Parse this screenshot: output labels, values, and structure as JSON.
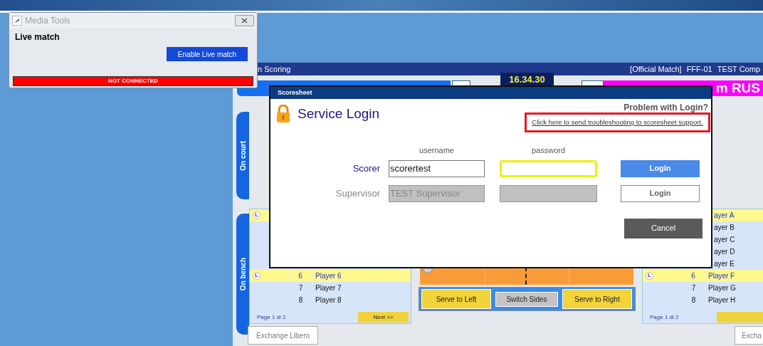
{
  "media_tools": {
    "title": "Media Tools",
    "heading": "Live match",
    "button": "Enable Live match",
    "status": "NOT CONNECTED"
  },
  "scoring_window": {
    "title": "n Scoring",
    "match_info": [
      "[Official Match]",
      "FFF-01",
      "TEST Comp"
    ],
    "clock": "16.34.30",
    "teams": [
      {
        "color": "#1470f0"
      },
      {
        "name": "m RUS",
        "color": "#ff00ff"
      }
    ],
    "side_tabs": [
      "On court",
      "On bench"
    ],
    "benches": [
      {
        "rows": [
          {
            "libero": true,
            "badge": "L"
          },
          {
            "libero": true,
            "badge": "L",
            "number": "6",
            "name": "Player 6"
          },
          {
            "libero": false,
            "number": "7",
            "name": "Player 7"
          },
          {
            "libero": false,
            "number": "8",
            "name": "Player 8"
          }
        ],
        "page": "Page 1 di 2",
        "next": "Next >>"
      },
      {
        "rows": [
          {
            "libero": true,
            "name": "ayer A"
          },
          {
            "libero": false,
            "name": "ayer B"
          },
          {
            "libero": false,
            "name": "ayer C"
          },
          {
            "libero": false,
            "name": "ayer D"
          },
          {
            "libero": false,
            "name": "ayer E"
          },
          {
            "libero": true,
            "badge": "L",
            "number": "6",
            "name": "Player F"
          },
          {
            "libero": false,
            "number": "7",
            "name": "Player G"
          },
          {
            "libero": false,
            "number": "8",
            "name": "Player H"
          }
        ],
        "page": "Page 1 di 2"
      }
    ],
    "court_buttons": [
      {
        "label": "Serve to Left",
        "kind": "serve"
      },
      {
        "label": "Switch Sides",
        "kind": "switch"
      },
      {
        "label": "Serve to Right",
        "kind": "serve"
      }
    ],
    "exchange_buttons": [
      "Exchange Libero",
      "Excha"
    ]
  },
  "login_dialog": {
    "title": "Scoresheet",
    "heading": "Service Login",
    "problem": "Problem with Login?",
    "support_link": "Click here to send troubleshooting to scoresheet support.",
    "columns": [
      "username",
      "password"
    ],
    "rows": [
      {
        "role": "Scorer",
        "username": "scorertest",
        "password_focused": true,
        "disabled": false,
        "button": "Login"
      },
      {
        "role": "Supervisor",
        "username": "TEST Supervisor",
        "password_focused": false,
        "disabled": true,
        "button": "Login"
      }
    ],
    "cancel": "Cancel"
  }
}
